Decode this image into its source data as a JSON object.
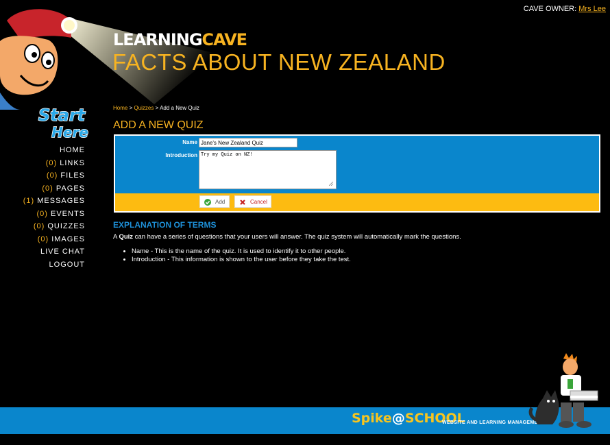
{
  "header": {
    "cave_owner_label": "CAVE OWNER:",
    "cave_owner_name": "Mrs Lee",
    "brand_word1": "LEARNING",
    "brand_word2": "CAVE",
    "site_title": "FACTS ABOUT NEW ZEALAND"
  },
  "start_here": {
    "line1": "Start",
    "line2": "Here"
  },
  "nav": [
    {
      "count": "",
      "label": "HOME"
    },
    {
      "count": "(0)",
      "label": "LINKS"
    },
    {
      "count": "(0)",
      "label": "FILES"
    },
    {
      "count": "(0)",
      "label": "PAGES"
    },
    {
      "count": "(1)",
      "label": "MESSAGES"
    },
    {
      "count": "(0)",
      "label": "EVENTS"
    },
    {
      "count": "(0)",
      "label": "QUIZZES"
    },
    {
      "count": "(0)",
      "label": "IMAGES"
    },
    {
      "count": "",
      "label": "LIVE CHAT"
    },
    {
      "count": "",
      "label": "LOGOUT"
    }
  ],
  "breadcrumb": {
    "home": "Home",
    "sep": ">",
    "quizzes": "Quizzes",
    "current": "Add a New Quiz"
  },
  "page_heading": "ADD A NEW QUIZ",
  "form": {
    "name_label": "Name",
    "name_value": "Jane's New Zealand Quiz",
    "intro_label": "Introduction",
    "intro_value": "Try my Quiz on NZ!",
    "add_label": "Add",
    "cancel_label": "Cancel",
    "add_icon": "check-circle-icon",
    "cancel_icon": "x-icon"
  },
  "explanation": {
    "heading": "EXPLANATION OF TERMS",
    "text_pre": "A ",
    "text_bold": "Quiz",
    "text_post": " can have a series of questions that your users will answer. The quiz system will automatically mark the questions.",
    "items": [
      "Name - This is the name of the quiz. It is used to identify it to other people.",
      "Introduction - This information is shown to the user before they take the test."
    ]
  },
  "footer": {
    "logo_spike": "Spike",
    "logo_at": "@",
    "logo_school": "SCHOOL",
    "tagline": "WEBSITE AND LEARNING MANAGEMENT"
  },
  "colors": {
    "accent": "#f7b321",
    "blue": "#0a86cc",
    "action_bar": "#fdbb11",
    "cancel": "#c62121"
  }
}
